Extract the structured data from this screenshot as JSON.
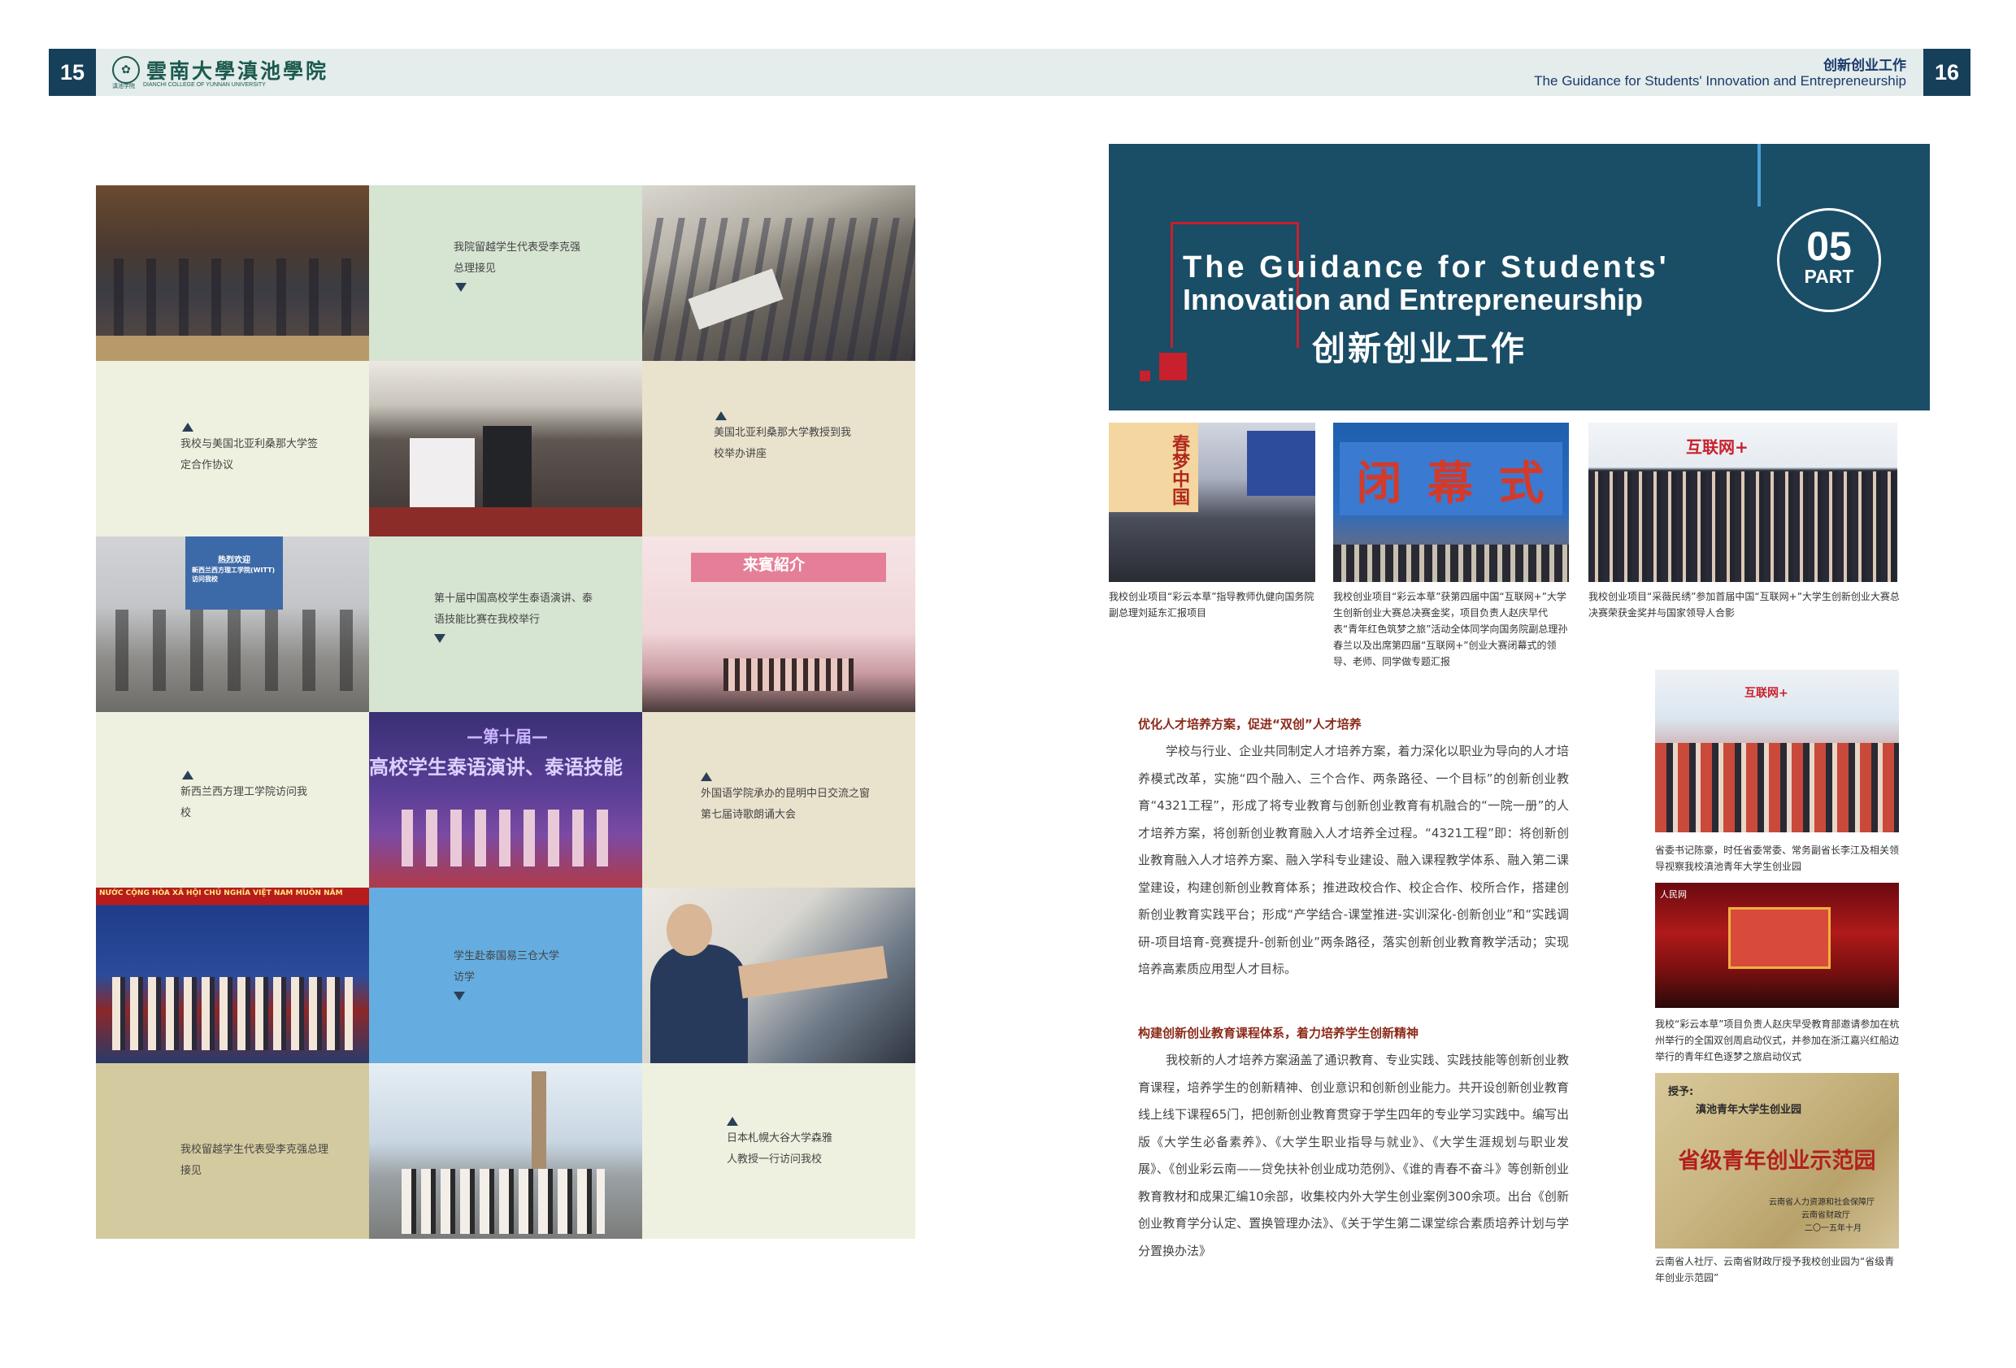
{
  "header": {
    "page_left": "15",
    "page_right": "16",
    "logo_cn": "雲南大學滇池學院",
    "logo_en": "DIANCHI COLLEGE OF YUNNAN UNIVERSITY",
    "logo_tag": "滇池学院",
    "section_cn": "创新创业工作",
    "section_en": "The Guidance for Students' Innovation and Entrepreneurship"
  },
  "grid": {
    "captions": [
      "我院留越学生代表受李克强总理接见",
      "我校与美国北亚利桑那大学签定合作协议",
      "美国北亚利桑那大学教授到我校举办讲座",
      "第十届中国高校学生泰语演讲、泰语技能比赛在我校举行",
      "新西兰西方理工学院访问我校",
      "外国语学院承办的昆明中日交流之窗第七届诗歌朗诵大会",
      "学生赴泰国易三仓大学访学",
      "我校留越学生代表受李克强总理接见",
      "日本札幌大谷大学森雅人教授一行访问我校"
    ],
    "photo_texts": {
      "welcome_title": "热烈欢迎",
      "welcome_sub": "新西兰西方理工学院(WITT)访问我校",
      "guest_intro": "来賓紹介",
      "thai_tenth": "—第十届—",
      "thai_title": "高校学生泰语演讲、泰语技能",
      "vn_banner": "NƯỚC CỘNG HÒA XÃ HỘI CHỦ NGHĨA VIỆT NAM MUÔN NĂM"
    }
  },
  "banner": {
    "title_en_1": "The Guidance for Students'",
    "title_en_2": "Innovation and Entrepreneurship",
    "title_cn": "创新创业工作",
    "part_num": "05",
    "part_label": "PART"
  },
  "photos": {
    "closing_text": "闭 幕 式",
    "spring_text": "春梦中国",
    "internet_plus": "互联网+",
    "certificate_to": "授予:",
    "certificate_org": "滇池青年大学生创业园",
    "certificate_title": "省级青年创业示范园",
    "certificate_issuer": "云南省人力资源和社会保障厅",
    "certificate_issuer2": "云南省财政厅",
    "certificate_date": "二〇一五年十月"
  },
  "captions_right": {
    "photo1": "我校创业项目“彩云本草”指导教师仇健向国务院副总理刘延东汇报项目",
    "photo2": "我校创业项目“彩云本草”获第四届中国“互联网+”大学生创新创业大赛总决赛金奖，项目负责人赵庆早代表“青年红色筑梦之旅”活动全体同学向国务院副总理孙春兰以及出席第四届“互联网+”创业大赛闭幕式的领导、老师、同学做专题汇报",
    "photo3": "我校创业项目“采薇民绣”参加首届中国“互联网+”大学生创新创业大赛总决赛荣获金奖并与国家领导人合影",
    "photo4": "省委书记陈豪，时任省委常委、常务副省长李江及相关领导视察我校滇池青年大学生创业园",
    "photo5": "我校“彩云本草”项目负责人赵庆早受教育部邀请参加在杭州举行的全国双创周启动仪式，并参加在浙江嘉兴红船边举行的青年红色逐梦之旅启动仪式",
    "photo6": "云南省人社厅、云南省财政厅授予我校创业园为“省级青年创业示范园”"
  },
  "article": {
    "heading1": "优化人才培养方案，促进“双创”人才培养",
    "para1": "学校与行业、企业共同制定人才培养方案，着力深化以职业为导向的人才培养模式改革，实施“四个融入、三个合作、两条路径、一个目标”的创新创业教育“4321工程”，形成了将专业教育与创新创业教育有机融合的“一院一册”的人才培养方案，将创新创业教育融入人才培养全过程。“4321工程”即：将创新创业教育融入人才培养方案、融入学科专业建设、融入课程教学体系、融入第二课堂建设，构建创新创业教育体系；推进政校合作、校企合作、校所合作，搭建创新创业教育实践平台；形成“产学结合-课堂推进-实训深化-创新创业”和“实践调研-项目培育-竞赛提升-创新创业”两条路径，落实创新创业教育教学活动；实现培养高素质应用型人才目标。",
    "heading2": "构建创新创业教育课程体系，着力培养学生创新精神",
    "para2": "我校新的人才培养方案涵盖了通识教育、专业实践、实践技能等创新创业教育课程，培养学生的创新精神、创业意识和创新创业能力。共开设创新创业教育线上线下课程65门，把创新创业教育贯穿于学生四年的专业学习实践中。编写出版《大学生必备素养》、《大学生职业指导与就业》、《大学生涯规划与职业发展》、《创业彩云南——贷免扶补创业成功范例》、《谁的青春不奋斗》等创新创业教育教材和成果汇编10余部，收集校内外大学生创业案例300余项。出台《创新创业教育学分认定、置换管理办法》、《关于学生第二课堂综合素质培养计划与学分置换办法》"
  },
  "colors": {
    "navy": "#163f5a",
    "banner": "#1a4d66",
    "red": "#c8202c",
    "sage": "#d6e4d2",
    "cream": "#eef1df",
    "tan": "#e9e2cd",
    "khaki": "#d4ca9f",
    "sky": "#65ade0"
  }
}
